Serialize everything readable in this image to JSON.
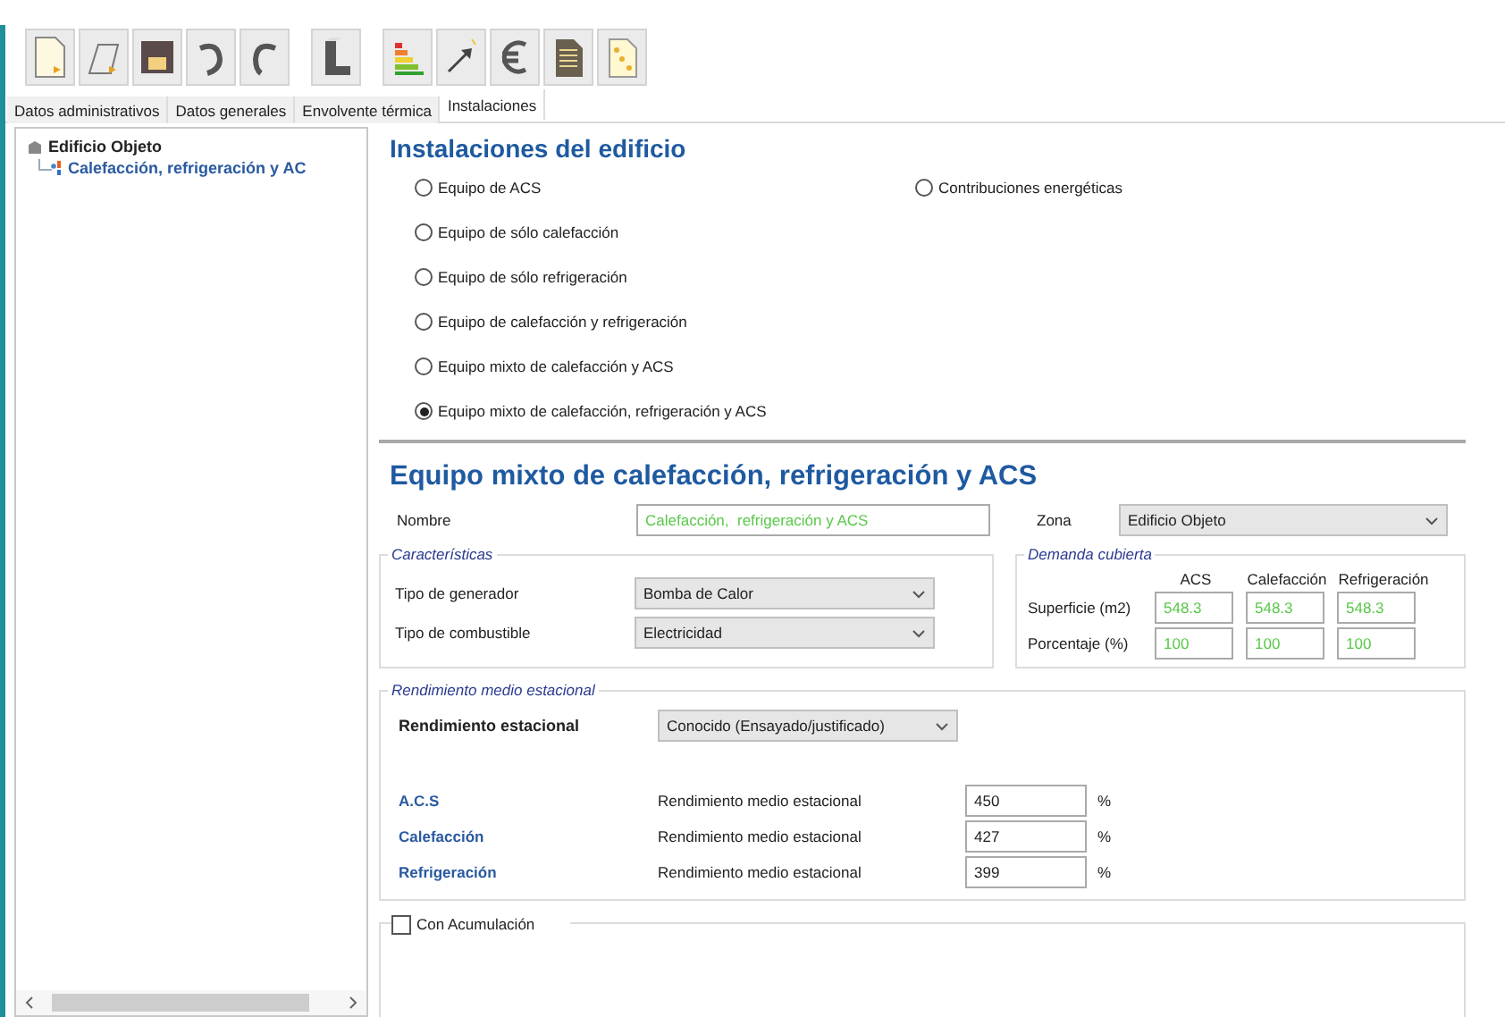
{
  "tabs": [
    {
      "label": "Datos administrativos",
      "selected": false
    },
    {
      "label": "Datos generales",
      "selected": false
    },
    {
      "label": "Envolvente térmica",
      "selected": false
    },
    {
      "label": "Instalaciones",
      "selected": true
    }
  ],
  "tree": {
    "label": "Edificio Objeto",
    "children": [
      {
        "label": "Calefacción,  refrigeración y AC"
      }
    ]
  },
  "installations": {
    "title": "Instalaciones del edificio",
    "options": [
      {
        "label": "Equipo de ACS",
        "selected": false
      },
      {
        "label": "Equipo de sólo calefacción",
        "selected": false
      },
      {
        "label": "Equipo de sólo refrigeración",
        "selected": false
      },
      {
        "label": "Equipo de calefacción y refrigeración",
        "selected": false
      },
      {
        "label": "Equipo mixto de calefacción y ACS",
        "selected": false
      },
      {
        "label": "Equipo mixto de calefacción, refrigeración y ACS",
        "selected": true
      }
    ],
    "side_options": [
      {
        "label": "Contribuciones energéticas",
        "selected": false
      }
    ]
  },
  "equipment": {
    "title": "Equipo mixto de calefacción, refrigeración y ACS",
    "name": {
      "label": "Nombre",
      "value": "Calefacción,  refrigeración y ACS"
    },
    "zone": {
      "label": "Zona",
      "value": "Edificio Objeto"
    },
    "characteristics": {
      "legend": "Características",
      "rows": [
        {
          "label": "Tipo de generador",
          "value": "Bomba de Calor"
        },
        {
          "label": "Tipo de combustible",
          "value": "Electricidad"
        }
      ]
    },
    "demand": {
      "legend": "Demanda cubierta",
      "columns": [
        "ACS",
        "Calefacción",
        "Refrigeración"
      ],
      "rows": [
        {
          "label": "Superficie (m2)",
          "values": [
            "548.3",
            "548.3",
            "548.3"
          ]
        },
        {
          "label": "Porcentaje (%)",
          "values": [
            "100",
            "100",
            "100"
          ]
        }
      ]
    },
    "performance": {
      "legend": "Rendimiento medio estacional",
      "label": "Rendimiento estacional",
      "value": "Conocido (Ensayado/justificado)",
      "rows": [
        {
          "label": "A.C.S",
          "description": "Rendimiento medio estacional",
          "value": "450",
          "unit": "%"
        },
        {
          "label": "Calefacción",
          "description": "Rendimiento medio estacional",
          "value": "427",
          "unit": "%"
        },
        {
          "label": "Refrigeración",
          "description": "Rendimiento medio estacional",
          "value": "399",
          "unit": "%"
        }
      ]
    },
    "storage": {
      "label": "Con Acumulación",
      "checked": false
    }
  }
}
